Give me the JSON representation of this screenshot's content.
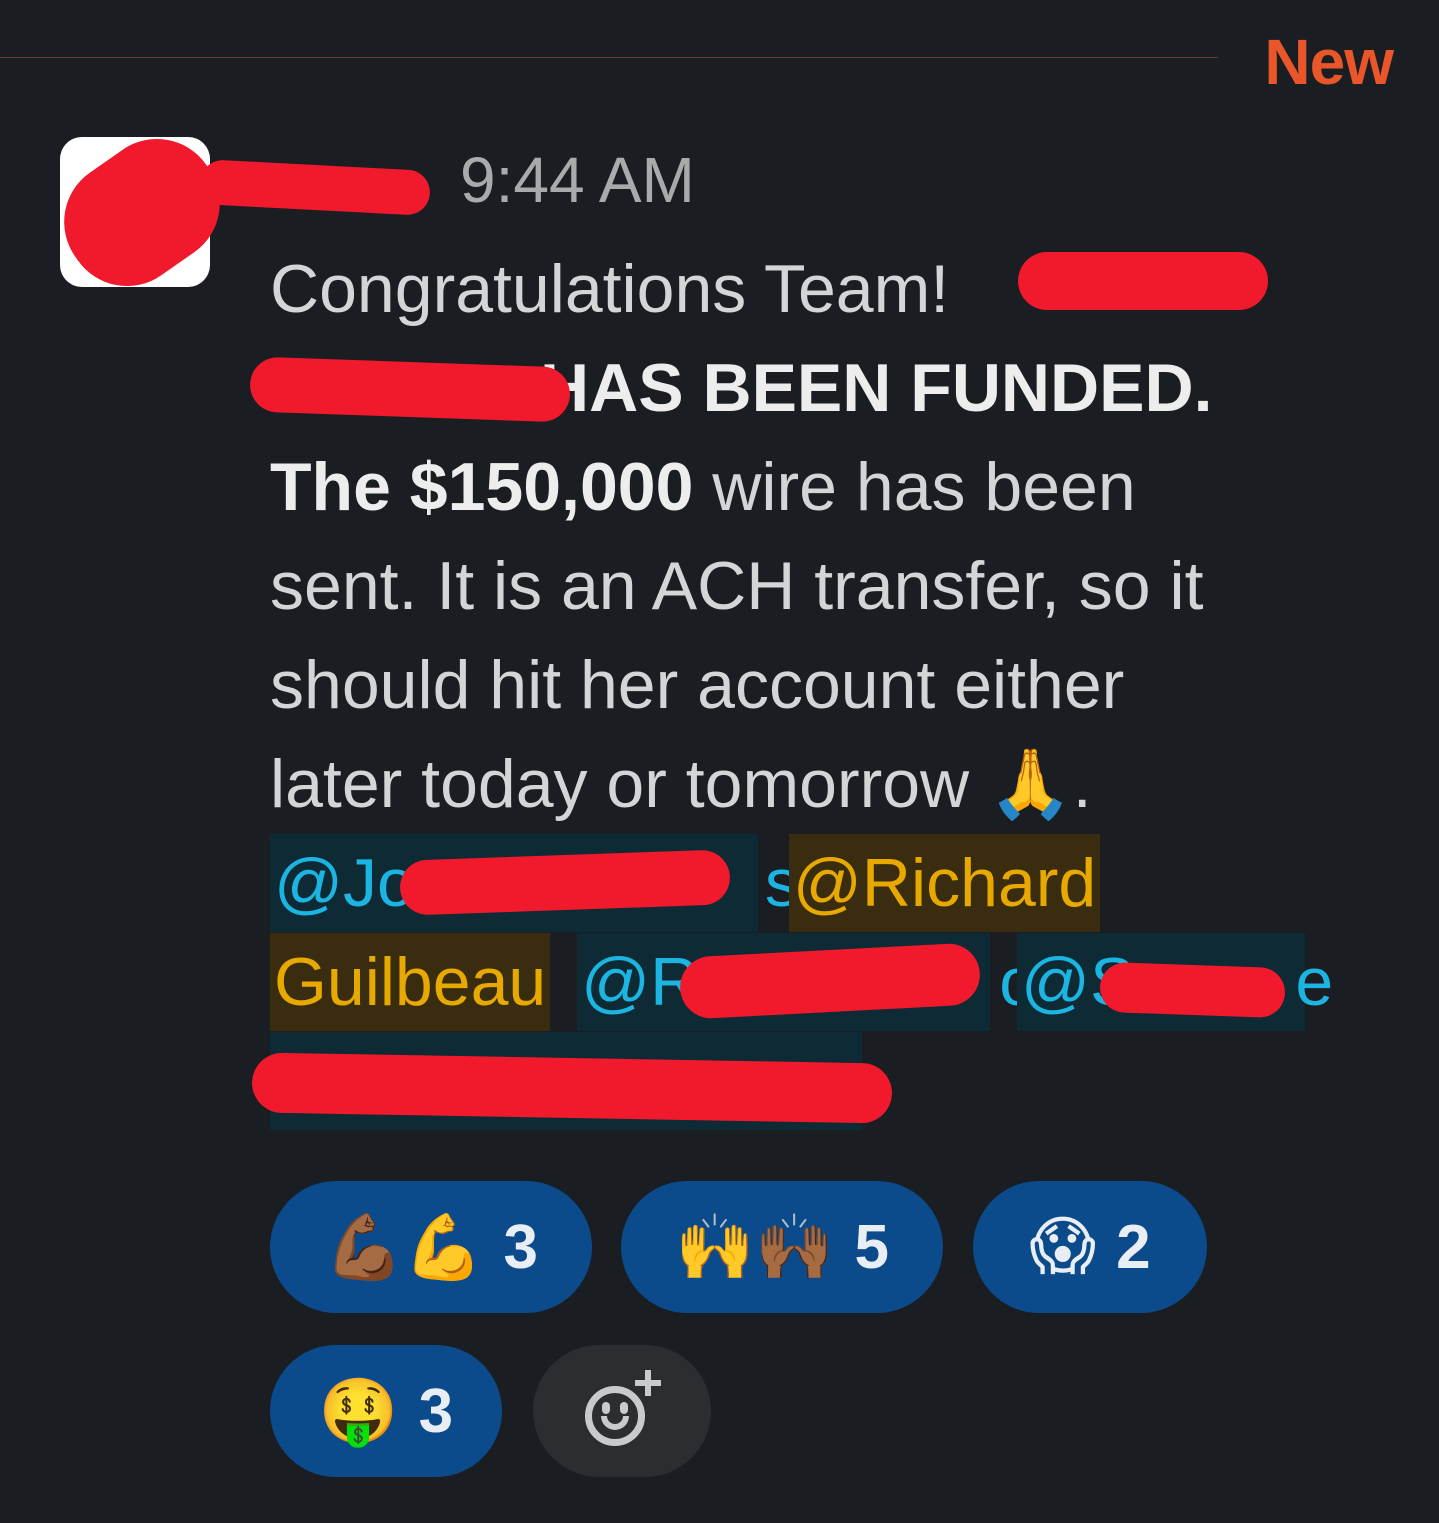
{
  "divider": {
    "label": "New"
  },
  "message": {
    "timestamp": "9:44 AM",
    "lines": {
      "l1": "Congratulations Team!",
      "l2_bold": "HAS BEEN FUNDED.",
      "l3_bold_a": "The $150,000",
      "l3_rest": " wire has been",
      "l4": "sent. It is an ACH transfer, so it",
      "l5": "should hit her account either",
      "l6": "later today or tomorrow",
      "l6_emoji": "🙏",
      "l6_end": "."
    },
    "mentions": {
      "john_start": "@Jo",
      "john_end": "s",
      "richard_a": "@Richard",
      "richard_b": "Guilbeau",
      "r_start": "@R",
      "r_end": "o",
      "s_start": "@S",
      "s_end": "e"
    }
  },
  "reactions": [
    {
      "emoji": "💪🏾💪",
      "count": "3"
    },
    {
      "emoji": "🙌🙌🏾",
      "count": "5"
    },
    {
      "emoji": "😱",
      "count": "2"
    },
    {
      "emoji": "🤑",
      "count": "3"
    }
  ],
  "colors": {
    "background": "#1a1d21",
    "new_label": "#e8562a",
    "mention_blue": "#1cb4e0",
    "mention_gold": "#e7a900",
    "reaction_bg": "#0b4b8c",
    "redaction": "#f01a2c"
  },
  "icons": {
    "add_reaction": "add-reaction-icon"
  }
}
